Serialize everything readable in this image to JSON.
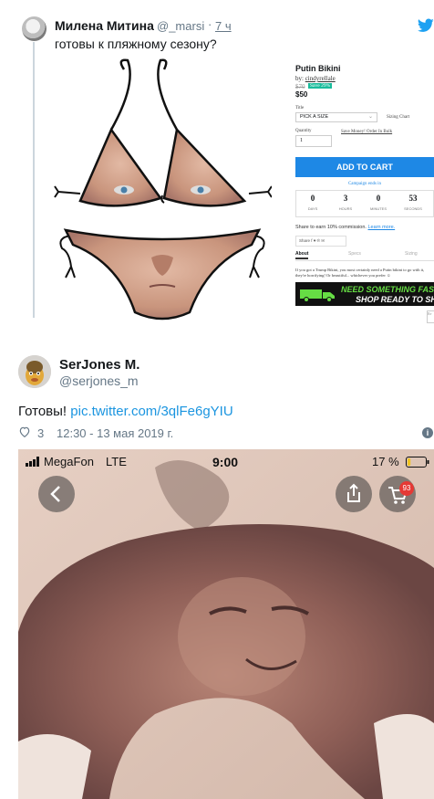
{
  "quoted_tweet": {
    "name": "Милена Митина",
    "handle": "@_marsi",
    "separator": "·",
    "time": "7 ч",
    "text": "готовы к пляжному сезону?"
  },
  "product": {
    "title": "Putin Bikini",
    "by_prefix": "by: ",
    "by_name": "cindyrellale",
    "old_price": "$70",
    "save_badge": "Save 29%",
    "price": "$50",
    "size_label": "Title",
    "size_value": "PICK A SIZE",
    "size_chart": "Sizing Chart",
    "qty_label": "Quantity",
    "qty_value": "1",
    "bulk_link": "Save Money! Order In Bulk",
    "cart_button": "ADD TO CART",
    "campaign_text": "Campaign ends in",
    "countdown": [
      {
        "value": "0",
        "label": "DAYS"
      },
      {
        "value": "3",
        "label": "HOURS"
      },
      {
        "value": "0",
        "label": "MINUTES"
      },
      {
        "value": "53",
        "label": "SECONDS"
      }
    ],
    "share_earn": "Share to earn 10% commission.",
    "learn_more": "Learn more.",
    "share_row": "Share f ♥ ℗ ✉",
    "tabs": [
      "About",
      "Specs",
      "Sizing"
    ],
    "description": "If you got a Trump Bikini, you most certainly need a Putin bikini to go with it, they're horrifying! Or beautiful... whichever you prefer ☺",
    "shipping_line1": "NEED SOMETHING FAST?",
    "shipping_line2": "SHOP READY TO SHIP",
    "small_button": "Re"
  },
  "tweet": {
    "author_name": "SerJones M.",
    "author_handle": "@serjones_m",
    "text": "Готовы! ",
    "link": "pic.twitter.com/3qlFe6gYIU",
    "likes": "3",
    "timestamp": "12:30 - 13 мая 2019 г."
  },
  "phone": {
    "carrier": "MegaFon",
    "network": "LTE",
    "clock": "9:00",
    "battery": "17 %",
    "battery_level": 0.17,
    "cart_count": "93"
  },
  "colors": {
    "link": "#1b95e0",
    "muted": "#657786",
    "cart_button": "#1e88e5",
    "save_badge": "#1abc9c",
    "banner_green": "#66dd44",
    "badge_red": "#e53935"
  },
  "icons": [
    "twitter-bird-icon",
    "heart-icon",
    "info-icon",
    "signal-icon",
    "battery-icon",
    "back-arrow-icon",
    "share-icon",
    "cart-icon",
    "truck-icon"
  ]
}
